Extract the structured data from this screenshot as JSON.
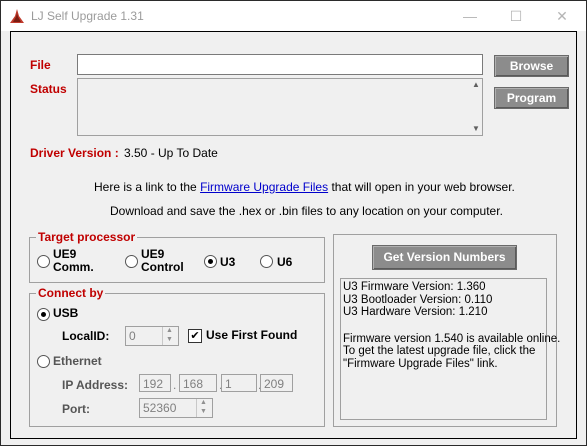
{
  "window": {
    "title": "LJ Self Upgrade 1.31",
    "icon": "labjack-logo-icon",
    "controls": [
      "minimize-icon",
      "maximize-icon",
      "close-icon"
    ]
  },
  "file": {
    "label": "File",
    "value": ""
  },
  "status": {
    "label": "Status",
    "value": ""
  },
  "buttons": {
    "browse": "Browse",
    "program": "Program",
    "get_version": "Get Version Numbers"
  },
  "driver": {
    "label": "Driver Version :",
    "value": "3.50 - Up To Date"
  },
  "info": {
    "line1_prefix": "Here is a link to the ",
    "link_text": "Firmware Upgrade Files",
    "line1_suffix": " that will open in your web browser.",
    "line2": "Download and save the .hex or .bin files to any location on your computer."
  },
  "target_processor": {
    "title": "Target processor",
    "options": [
      {
        "line1": "UE9",
        "line2": "Comm.",
        "checked": false
      },
      {
        "line1": "UE9",
        "line2": "Control",
        "checked": false
      },
      {
        "line1": "U3",
        "line2": "",
        "checked": true
      },
      {
        "line1": "U6",
        "line2": "",
        "checked": false
      }
    ]
  },
  "connect_by": {
    "title": "Connect by",
    "usb_label": "USB",
    "usb_checked": true,
    "localid_label": "LocalID:",
    "localid_value": "0",
    "use_first_found_label": "Use First Found",
    "use_first_found_checked": true,
    "ethernet_label": "Ethernet",
    "ethernet_checked": false,
    "ip_label": "IP Address:",
    "ip": [
      "192",
      "168",
      "1",
      "209"
    ],
    "port_label": "Port:",
    "port_value": "52360"
  },
  "version_output": {
    "lines": [
      "U3 Firmware Version: 1.360",
      "U3 Bootloader Version: 0.110",
      "U3 Hardware Version: 1.210",
      "",
      "Firmware version 1.540 is available online.",
      "To get the latest upgrade file, click the",
      "\"Firmware Upgrade Files\" link."
    ]
  }
}
